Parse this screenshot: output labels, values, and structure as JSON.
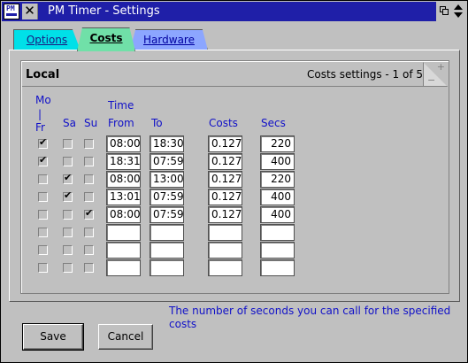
{
  "window": {
    "title": "PM Timer - Settings",
    "app_icon_text": "PM"
  },
  "tabs": [
    {
      "label": "Options",
      "active": false
    },
    {
      "label": "Costs",
      "active": true
    },
    {
      "label": "Hardware",
      "active": false
    }
  ],
  "page": {
    "section_title": "Local",
    "page_indicator": "Costs settings - 1 of 5"
  },
  "columns": {
    "mofr": [
      "Mo",
      "|",
      "Fr"
    ],
    "sa": "Sa",
    "su": "Su",
    "time": "Time",
    "from": "From",
    "to": "To",
    "costs": "Costs",
    "secs": "Secs"
  },
  "rows": [
    {
      "mofr": true,
      "sa": false,
      "su": false,
      "from": "08:00",
      "to": "18:30",
      "costs": "0.127",
      "secs": "220"
    },
    {
      "mofr": true,
      "sa": false,
      "su": false,
      "from": "18:31",
      "to": "07:59",
      "costs": "0.127",
      "secs": "400"
    },
    {
      "mofr": false,
      "sa": true,
      "su": false,
      "from": "08:00",
      "to": "13:00",
      "costs": "0.127",
      "secs": "220"
    },
    {
      "mofr": false,
      "sa": true,
      "su": false,
      "from": "13:01",
      "to": "07:59",
      "costs": "0.127",
      "secs": "400"
    },
    {
      "mofr": false,
      "sa": false,
      "su": true,
      "from": "08:00",
      "to": "07:59",
      "costs": "0.127",
      "secs": "400"
    },
    {
      "mofr": false,
      "sa": false,
      "su": false,
      "from": "",
      "to": "",
      "costs": "",
      "secs": ""
    },
    {
      "mofr": false,
      "sa": false,
      "su": false,
      "from": "",
      "to": "",
      "costs": "",
      "secs": ""
    },
    {
      "mofr": false,
      "sa": false,
      "su": false,
      "from": "",
      "to": "",
      "costs": "",
      "secs": ""
    }
  ],
  "help_text": "The number of seconds you can call for the specified costs",
  "buttons": {
    "save": "Save",
    "cancel": "Cancel"
  },
  "colors": {
    "titlebar": "#1f1fa8",
    "tab_options": "#00e0e8",
    "tab_costs": "#70e0a8",
    "tab_hardware": "#8ca6ff",
    "label_blue": "#1010c8"
  }
}
